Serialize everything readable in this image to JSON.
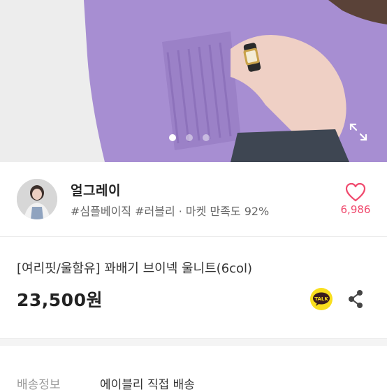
{
  "hero": {
    "image_alt": "lavender knit sweater with wristwatch",
    "page_indicator": {
      "count": 3,
      "active": 1
    },
    "expand_icon": "expand-icon"
  },
  "seller": {
    "name": "얼그레이",
    "tags": "#심플베이직 #러블리 · 마켓 만족도 92%",
    "likes": "6,986",
    "heart_icon": "heart-outline-icon",
    "heart_color": "#f0496d"
  },
  "product": {
    "title": "[여리핏/울함유] 꽈배기 브이넥 울니트(6col)",
    "price": "23,500원",
    "talk_icon_text": "TALK"
  },
  "shipping": {
    "label": "배송정보",
    "value": "에이블리 직접 배송"
  }
}
